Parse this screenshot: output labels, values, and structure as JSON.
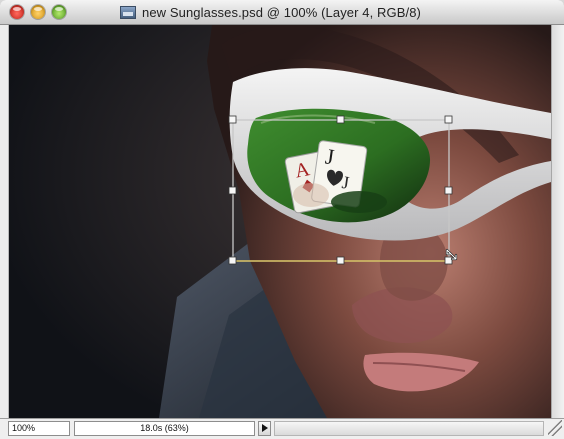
{
  "window": {
    "title": "new Sunglasses.psd @ 100% (Layer 4, RGB/8)",
    "icons": {
      "document": "psd-document-icon",
      "close": "close-icon",
      "minimize": "minimize-icon",
      "maximize": "maximize-icon"
    }
  },
  "statusbar": {
    "zoom": "100%",
    "info": "18.0s (63%)",
    "info_menu_icon": "triangle-right-icon"
  },
  "colors": {
    "close": "#d9342a",
    "minimize": "#e8a416",
    "maximize": "#5bb32b",
    "selection": "#9a9a9a"
  }
}
